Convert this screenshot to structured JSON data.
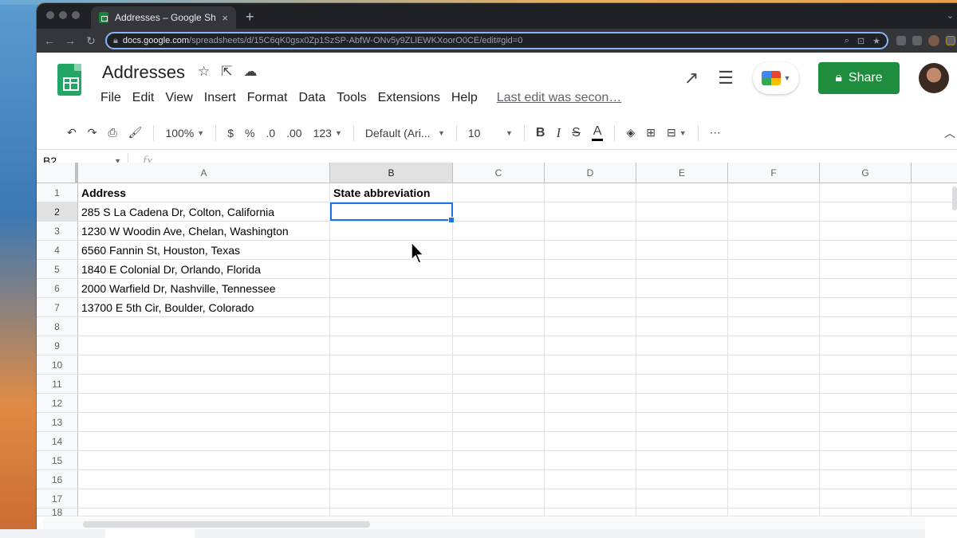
{
  "browser": {
    "tab_title": "Addresses – Google Sheets",
    "tab_close": "×",
    "new_tab": "+",
    "url_domain": "docs.google.com",
    "url_path": "/spreadsheets/d/15C6qK0gsx0Zp1SzSP-AbfW-ONv5y9ZLlEWKXoorO0CE/edit#gid=0"
  },
  "doc": {
    "title": "Addresses",
    "menu": [
      "File",
      "Edit",
      "View",
      "Insert",
      "Format",
      "Data",
      "Tools",
      "Extensions",
      "Help"
    ],
    "last_edit": "Last edit was secon…",
    "share_label": "Share"
  },
  "toolbar": {
    "zoom": "100%",
    "currency": "$",
    "percent": "%",
    "decrease_decimal": ".0",
    "increase_decimal": ".00",
    "more_formats": "123",
    "font": "Default (Ari...",
    "font_size": "10",
    "bold": "B",
    "italic": "I",
    "strike": "S",
    "text_color": "A"
  },
  "formula_bar": {
    "name_box": "B2",
    "fx": "fx",
    "value": ""
  },
  "grid": {
    "columns": [
      "A",
      "B",
      "C",
      "D",
      "E",
      "F",
      "G",
      ""
    ],
    "active_column": "B",
    "active_row": "2",
    "rows": [
      {
        "num": "1",
        "A": "Address",
        "B": "State abbreviation"
      },
      {
        "num": "2",
        "A": "285 S La Cadena Dr, Colton, California",
        "B": ""
      },
      {
        "num": "3",
        "A": "1230 W Woodin Ave, Chelan, Washington",
        "B": ""
      },
      {
        "num": "4",
        "A": "6560 Fannin St, Houston, Texas",
        "B": ""
      },
      {
        "num": "5",
        "A": "1840 E Colonial Dr, Orlando, Florida",
        "B": ""
      },
      {
        "num": "6",
        "A": "2000 Warfield Dr, Nashville, Tennessee",
        "B": ""
      },
      {
        "num": "7",
        "A": "13700 E 5th Cir, Boulder, Colorado",
        "B": ""
      },
      {
        "num": "8",
        "A": "",
        "B": ""
      },
      {
        "num": "9",
        "A": "",
        "B": ""
      },
      {
        "num": "10",
        "A": "",
        "B": ""
      },
      {
        "num": "11",
        "A": "",
        "B": ""
      },
      {
        "num": "12",
        "A": "",
        "B": ""
      },
      {
        "num": "13",
        "A": "",
        "B": ""
      },
      {
        "num": "14",
        "A": "",
        "B": ""
      },
      {
        "num": "15",
        "A": "",
        "B": ""
      },
      {
        "num": "16",
        "A": "",
        "B": ""
      },
      {
        "num": "17",
        "A": "",
        "B": ""
      },
      {
        "num": "18",
        "A": "",
        "B": ""
      }
    ]
  },
  "colors": {
    "selection": "#1a73e8",
    "share_button": "#1e8e3e",
    "sheets_green": "#23a566"
  }
}
